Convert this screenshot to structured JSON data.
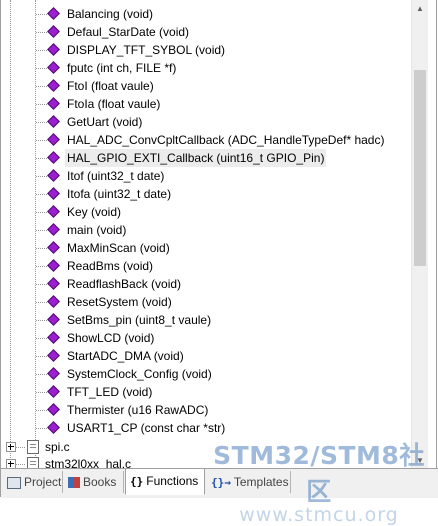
{
  "functions": [
    "Balancing (void)",
    "Defaul_StarDate (void)",
    "DISPLAY_TFT_SYBOL (void)",
    "fputc (int ch, FILE *f)",
    "FtoI (float vaule)",
    "FtoIa (float vaule)",
    "GetUart (void)",
    "HAL_ADC_ConvCpltCallback (ADC_HandleTypeDef* hadc)",
    "HAL_GPIO_EXTI_Callback (uint16_t GPIO_Pin)",
    "Itof (uint32_t date)",
    "Itofa (uint32_t date)",
    "Key (void)",
    "main (void)",
    "MaxMinScan (void)",
    "ReadBms (void)",
    "ReadflashBack (void)",
    "ResetSystem (void)",
    "SetBms_pin (uint8_t vaule)",
    "ShowLCD (void)",
    "StartADC_DMA (void)",
    "SystemClock_Config (void)",
    "TFT_LED (void)",
    "Thermister (u16 RawADC)",
    "USART1_CP (const char *str)"
  ],
  "highlighted_index": 8,
  "files": [
    "spi.c",
    "stm32l0xx_hal.c"
  ],
  "tabs": {
    "project": "Project",
    "books": "Books",
    "functions": "Functions",
    "templates": "Templates"
  },
  "tab_icons": {
    "functions": "{}",
    "templates": "{}→"
  },
  "watermark": {
    "title": "STM32/STM8社区",
    "url": "www.stmcu.org"
  },
  "colors": {
    "function_diamond": "#9b1fd0",
    "highlight_bg": "#ececec",
    "tabbar_bg": "#f0f0f0"
  }
}
